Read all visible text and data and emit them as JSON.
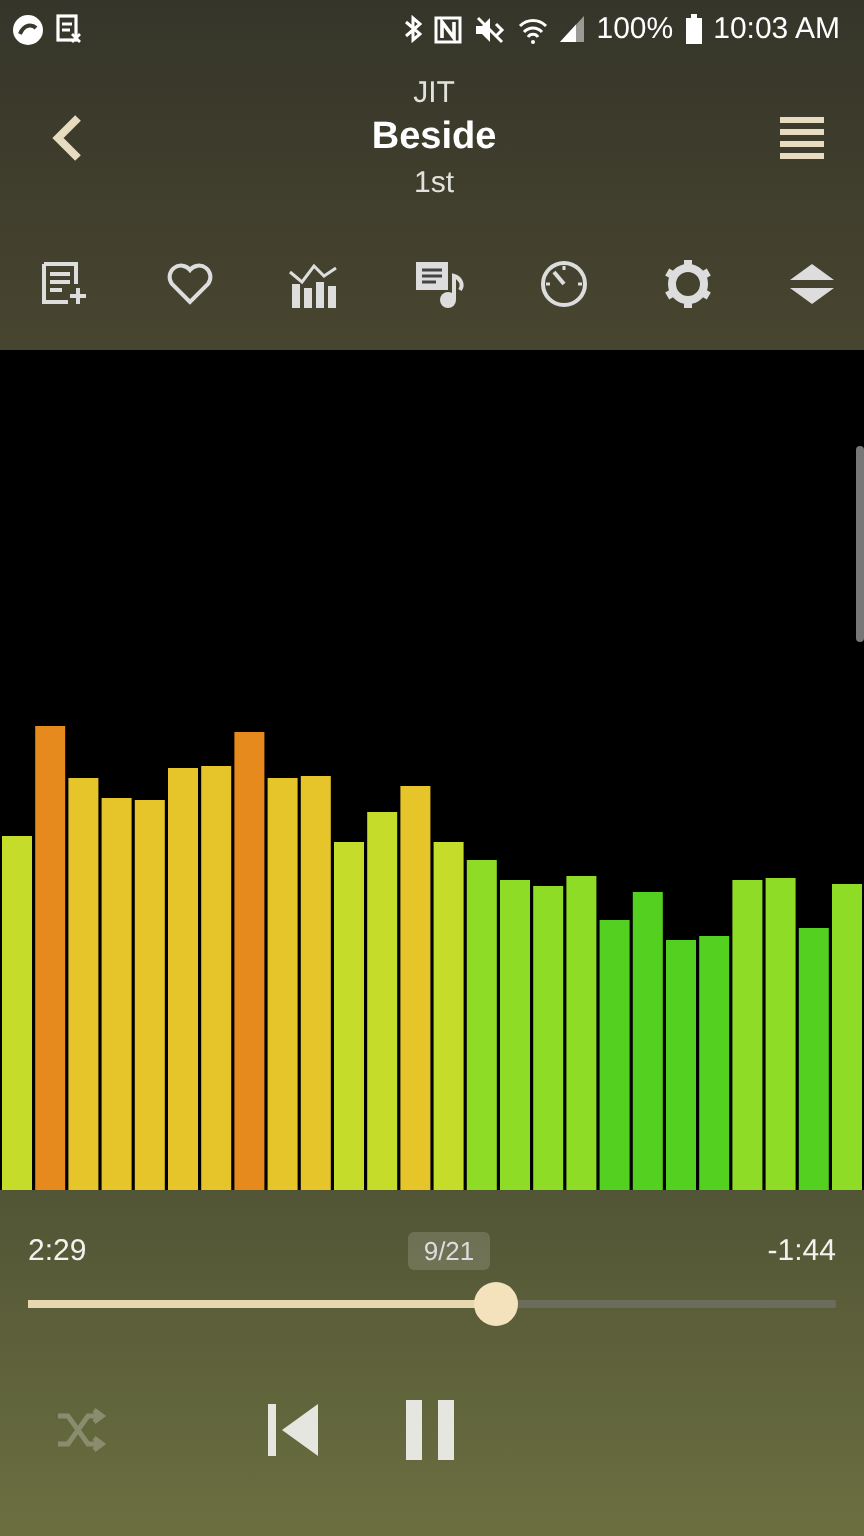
{
  "status_bar": {
    "battery": "100%",
    "time": "10:03 AM"
  },
  "header": {
    "artist": "JIT",
    "title": "Beside",
    "album": "1st"
  },
  "playback": {
    "elapsed": "2:29",
    "track_position": "9/21",
    "remaining": "-1:44",
    "level": 0.58
  },
  "controls": {
    "shuffle": false,
    "playing": true
  }
}
